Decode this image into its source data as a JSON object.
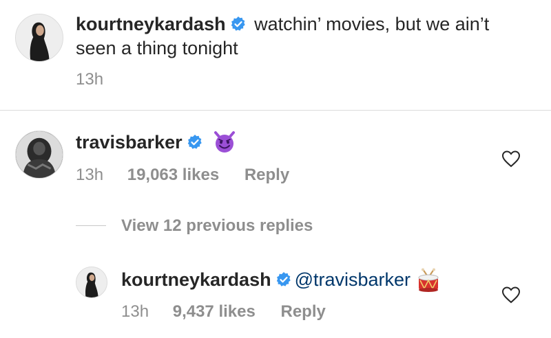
{
  "post_caption": {
    "username": "kourtneykardash",
    "text_line1": "watchin’ movies, but we ain’t",
    "text_line2": "seen a thing tonight",
    "time": "13h"
  },
  "comment": {
    "username": "travisbarker",
    "emoji": "smiling-devil-emoji",
    "time": "13h",
    "likes": "19,063 likes",
    "reply_label": "Reply"
  },
  "view_replies": {
    "label": "View 12 previous replies"
  },
  "reply": {
    "username": "kourtneykardash",
    "mention": "@travisbarker",
    "emoji": "drum-emoji",
    "time": "13h",
    "likes": "9,437 likes",
    "reply_label": "Reply"
  },
  "colors": {
    "text": "#262626",
    "meta": "#8e8e8e",
    "verified": "#3897f0",
    "mention": "#00376b",
    "devil_emoji": "#9b4fd6"
  }
}
